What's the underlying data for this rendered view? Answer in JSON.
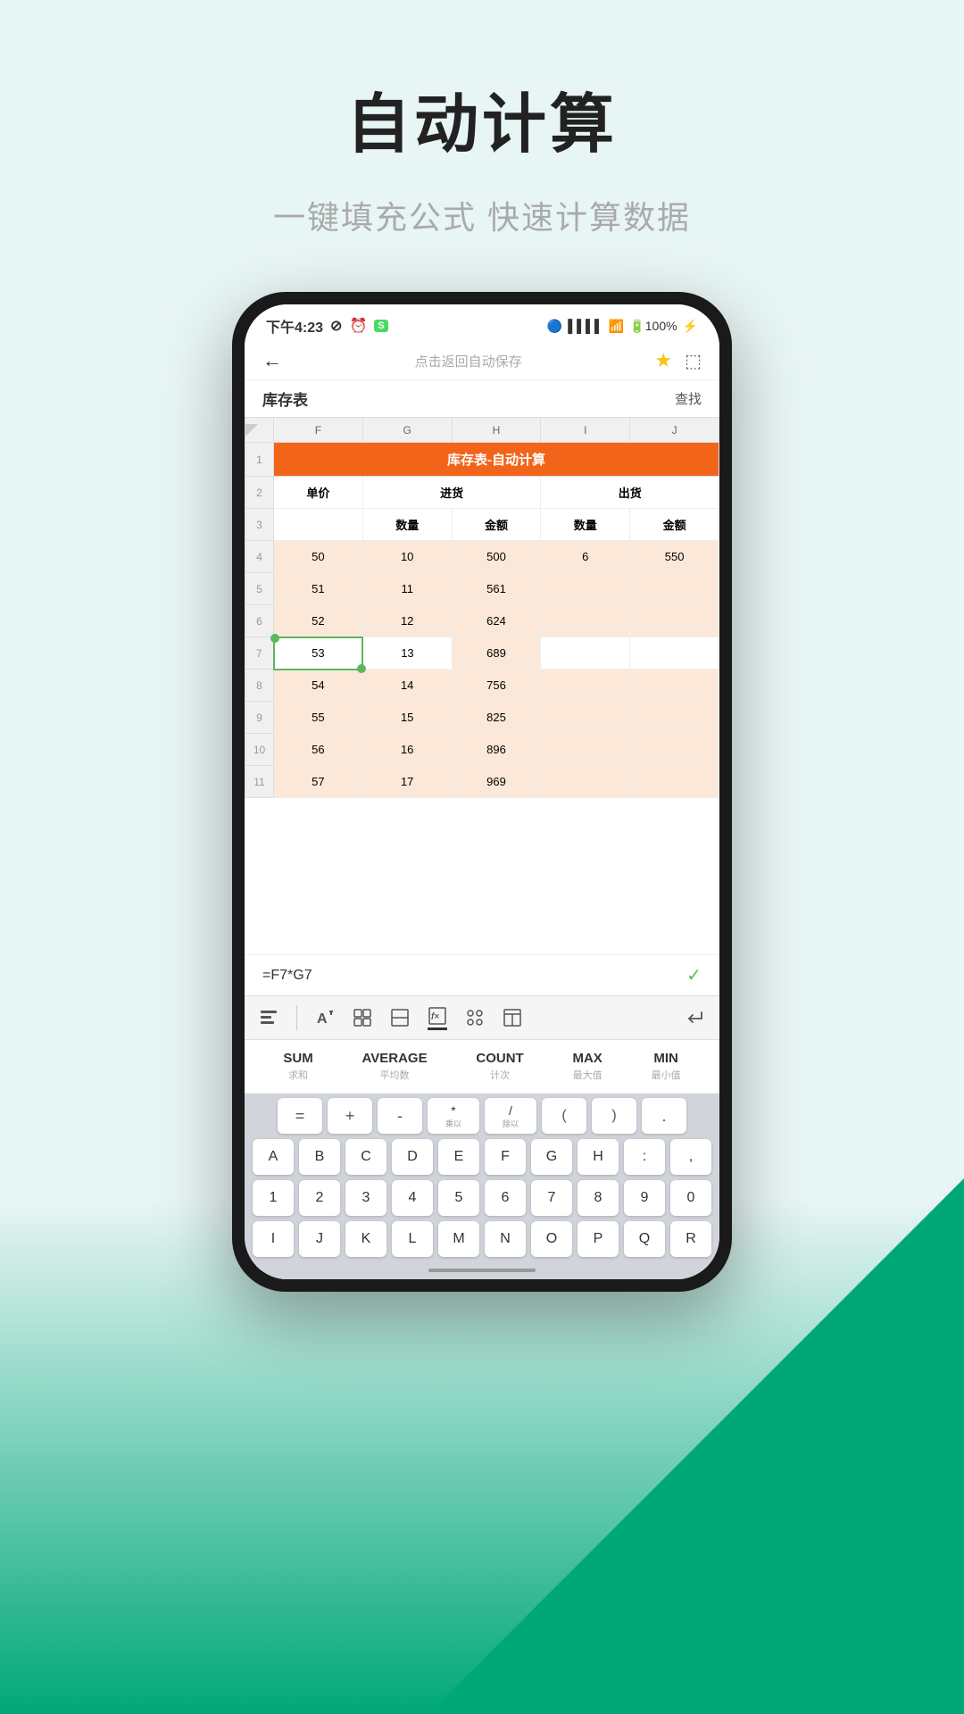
{
  "page": {
    "title": "自动计算",
    "subtitle": "一键填充公式 快速计算数据"
  },
  "status_bar": {
    "time": "下午4:23",
    "icons": "bluetooth signal wifi battery"
  },
  "nav": {
    "back": "←",
    "center": "点击返回自动保存",
    "star": "★",
    "export": "⬡"
  },
  "sheet": {
    "name": "库存表",
    "find": "查找"
  },
  "spreadsheet": {
    "col_headers": [
      "F",
      "G",
      "H",
      "I",
      "J"
    ],
    "title_row": "库存表-自动计算",
    "row2_headers": [
      "单价",
      "进货",
      "",
      "出货",
      ""
    ],
    "row3_headers": [
      "",
      "数量",
      "金额",
      "数量",
      "金额"
    ],
    "rows": [
      {
        "num": 4,
        "f": "50",
        "g": "10",
        "h": "500",
        "i": "6",
        "j": "550",
        "highlight": true
      },
      {
        "num": 5,
        "f": "51",
        "g": "11",
        "h": "561",
        "i": "",
        "j": "",
        "highlight": true
      },
      {
        "num": 6,
        "f": "52",
        "g": "12",
        "h": "624",
        "i": "",
        "j": "",
        "highlight": true
      },
      {
        "num": 7,
        "f": "53",
        "g": "13",
        "h": "689",
        "i": "",
        "j": "",
        "selected_f": true
      },
      {
        "num": 8,
        "f": "54",
        "g": "14",
        "h": "756",
        "i": "",
        "j": "",
        "highlight": true
      },
      {
        "num": 9,
        "f": "55",
        "g": "15",
        "h": "825",
        "i": "",
        "j": "",
        "highlight": true
      },
      {
        "num": 10,
        "f": "56",
        "g": "16",
        "h": "896",
        "i": "",
        "j": "",
        "highlight": true
      },
      {
        "num": 11,
        "f": "57",
        "g": "17",
        "h": "969",
        "i": "",
        "j": "",
        "highlight": true
      }
    ]
  },
  "formula": {
    "text": "=F7*G7",
    "check": "✓"
  },
  "toolbar": {
    "icons": [
      "▤",
      "A↑",
      "⊞",
      "⊡",
      "⊠",
      "⠿",
      "⊟",
      "↵"
    ]
  },
  "functions": [
    {
      "name": "SUM",
      "desc": "求和"
    },
    {
      "name": "AVERAGE",
      "desc": "平均数"
    },
    {
      "name": "COUNT",
      "desc": "计次"
    },
    {
      "name": "MAX",
      "desc": "最大值"
    },
    {
      "name": "MIN",
      "desc": "最小值"
    }
  ],
  "keyboard": {
    "ops_row": [
      "=",
      "+",
      "-",
      "* 乘以",
      "/ 除以",
      "(",
      ")",
      "."
    ],
    "letters_row1": [
      "A",
      "B",
      "C",
      "D",
      "E",
      "F",
      "G",
      "H",
      ":",
      ","
    ],
    "letters_row2": [
      "1",
      "2",
      "3",
      "4",
      "5",
      "6",
      "7",
      "8",
      "9",
      "0"
    ],
    "letters_row3": [
      "I",
      "J",
      "K",
      "L",
      "M",
      "N",
      "O",
      "P",
      "Q",
      "R"
    ]
  }
}
